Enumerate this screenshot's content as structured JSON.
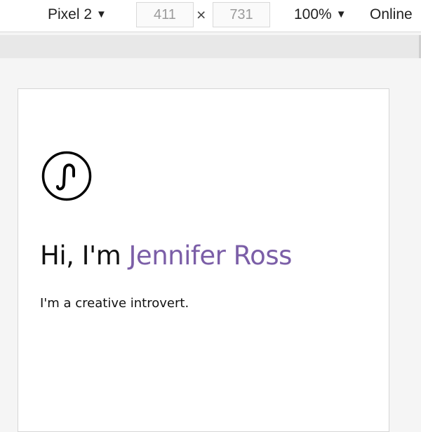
{
  "devtools": {
    "device": "Pixel 2",
    "width": "411",
    "height": "731",
    "dimension_separator": "×",
    "zoom": "100%",
    "network": "Online"
  },
  "page": {
    "logo_icon": "js-monogram-logo-icon",
    "greeting_prefix": "Hi, I'm ",
    "name": "Jennifer Ross",
    "tagline": "I'm a creative introvert.",
    "accent_color": "#7b5ea7"
  }
}
